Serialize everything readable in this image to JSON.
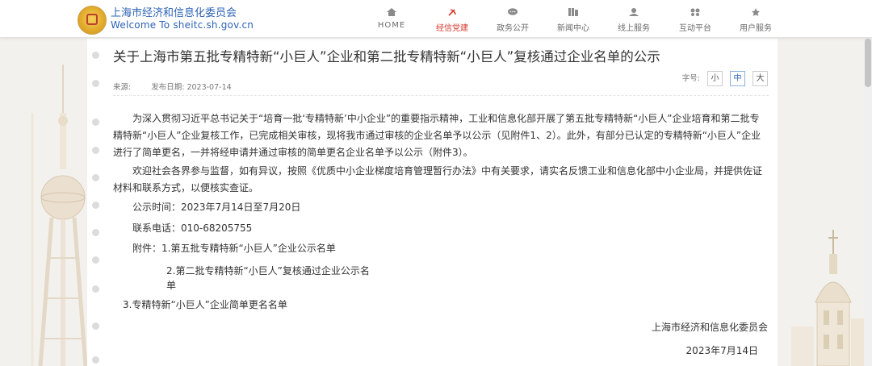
{
  "header": {
    "site_name": "上海市经济和信息化委员会",
    "site_url": "Welcome To sheitc.sh.gov.cn",
    "nav": [
      {
        "label": "HOME",
        "icon": "home-icon",
        "active": false
      },
      {
        "label": "经信党建",
        "icon": "party-emblem-icon",
        "active": true
      },
      {
        "label": "政务公开",
        "icon": "chat-bubble-icon",
        "active": false
      },
      {
        "label": "新闻中心",
        "icon": "news-icon",
        "active": false
      },
      {
        "label": "线上服务",
        "icon": "user-service-icon",
        "active": false
      },
      {
        "label": "互动平台",
        "icon": "interaction-icon",
        "active": false
      },
      {
        "label": "用户服务",
        "icon": "star-icon",
        "active": false
      }
    ],
    "accent_color": "#d43a2e",
    "brand_color": "#2d63b5"
  },
  "article": {
    "title": "关于上海市第五批专精特新“小巨人”企业和第二批专精特新“小巨人”复核通过企业名单的公示",
    "source_label": "来源:",
    "date_label": "发布日期: 2023-07-14",
    "font_size_label": "字号:",
    "font_sizes": [
      "小",
      "中",
      "大"
    ],
    "paragraph1": "为深入贯彻习近平总书记关于“培育一批‘专精特新’中小企业”的重要指示精神，工业和信息化部开展了第五批专精特新“小巨人”企业培育和第二批专精特新“小巨人”企业复核工作，已完成相关审核，现将我市通过审核的企业名单予以公示（见附件1、2）。此外，有部分已认定的专精特新“小巨人”企业进行了简单更名，一并将经申请并通过审核的简单更名企业名单予以公示（附件3）。",
    "paragraph2": "欢迎社会各界参与监督，如有异议，按照《优质中小企业梯度培育管理暂行办法》中有关要求，请实名反馈工业和信息化部中小企业局，并提供佐证材料和联系方式，以便核实查证。",
    "period": "公示时间：2023年7月14日至7月20日",
    "phone": "联系电话：010-68205755",
    "attachment1": "附件：1.第五批专精特新“小巨人”企业公示名单",
    "attachment2": "2.第二批专精特新“小巨人”复核通过企业公示名单",
    "attachment3": "3.专精特新“小巨人”企业简单更名名单",
    "signature": "上海市经济和信息化委员会",
    "sign_date": "2023年7月14日"
  }
}
